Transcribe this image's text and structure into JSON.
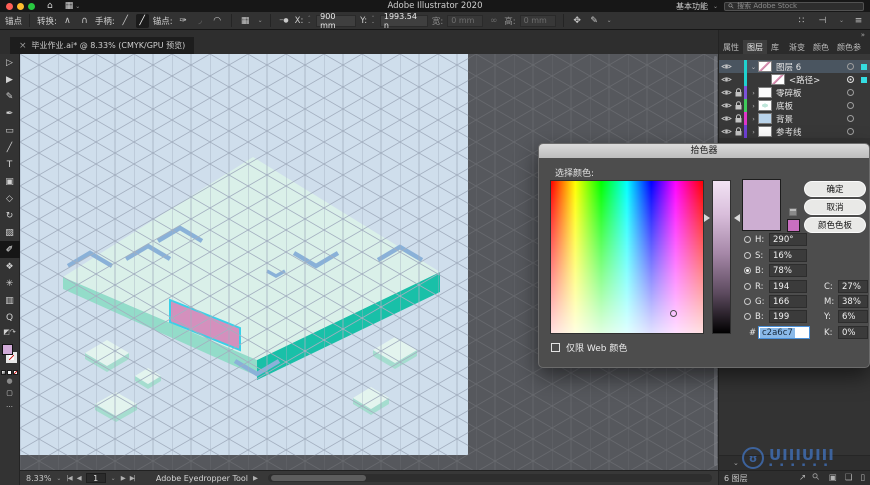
{
  "window_controls": {
    "close_color": "#ff5f57",
    "minimize_color": "#febc2e",
    "zoom_color": "#28c840"
  },
  "menubar": {
    "title": "Adobe Illustrator 2020",
    "home_icon": "⌂",
    "layout_icon": "▦",
    "chevron": "⌄",
    "workspace": "基本功能",
    "search_placeholder": "搜索 Adobe Stock",
    "search_icon": "⚲"
  },
  "controlbar": {
    "tool_label": "锚点",
    "convert_label": "转换:",
    "convert_corner_icon": "∧",
    "convert_smooth_icon": "∩",
    "handles_label": "手柄:",
    "handle_show_icon": "╱",
    "handle_hide_icon": "╱",
    "anchors_label": "锚点:",
    "anchor_pen_icon": "✑",
    "anchor_corner_icon": "◞",
    "anchor_smooth_icon": "◠",
    "grid_icon": "▦",
    "point_icon": "─●",
    "x_label": "X:",
    "x_value": "900 mm",
    "y_label": "Y:",
    "y_value": "1993.54 n",
    "w_label": "宽:",
    "w_value": "0 mm",
    "link_icon": "∞",
    "h_label": "高:",
    "h_value": "0 mm",
    "transform_icon": "✥",
    "shape_icon": "✎",
    "dots_icon": "∷",
    "dock_icon": "⊣",
    "menu_icon": "≡",
    "stepper_up": "⌃",
    "stepper_down": "⌄",
    "chevron": "⌄"
  },
  "docbar": {
    "close": "×",
    "tab_title": "毕业作业.ai* @ 8.33% (CMYK/GPU 预览)"
  },
  "tools": [
    {
      "name": "selection-tool",
      "glyph": "▷"
    },
    {
      "name": "direct-selection-tool",
      "glyph": "▶"
    },
    {
      "name": "curvature-tool",
      "glyph": "✎"
    },
    {
      "name": "pen-tool",
      "glyph": "✒"
    },
    {
      "name": "rectangle-tool",
      "glyph": "▭"
    },
    {
      "name": "paintbrush-tool",
      "glyph": "╱"
    },
    {
      "name": "type-tool",
      "glyph": "T"
    },
    {
      "name": "artboard-tool",
      "glyph": "▣"
    },
    {
      "name": "shaper-tool",
      "glyph": "◇"
    },
    {
      "name": "rotate-tool",
      "glyph": "↻"
    },
    {
      "name": "gradient-tool",
      "glyph": "▨"
    },
    {
      "name": "eyedropper-tool",
      "glyph": "✐"
    },
    {
      "name": "blend-tool",
      "glyph": "❖"
    },
    {
      "name": "symbol-sprayer-tool",
      "glyph": "✳"
    },
    {
      "name": "column-graph-tool",
      "glyph": "▥"
    },
    {
      "name": "zoom-tool",
      "glyph": "Q"
    }
  ],
  "toolbar_widgets": {
    "toggle_icon": "◩",
    "swap_icon": "↷",
    "draw_mode_icon": "●",
    "screen_mode_icon": "▢",
    "more_icon": "…",
    "fill_color": "#d2abd8"
  },
  "canvas": {
    "colors": {
      "outer": "#56585d",
      "grid_outer": "#67696e",
      "artboard": "#cfdeec",
      "grid_artboard": "#a3afc0",
      "platform_top": "#daf0e9",
      "edge_se": "#19c0a8",
      "edge_sw": "#93dcc9",
      "chevron": "#8ab1d8",
      "wall": "#d490bd",
      "wall_outline": "#3ad0e8",
      "tile_top": "#e3f4ee",
      "tile_side": "#a5ddcf"
    }
  },
  "statusbar": {
    "zoom": "8.33%",
    "chevron": "⌄",
    "nav_first": "|◀",
    "nav_prev": "◀",
    "page": "1",
    "nav_next": "▶",
    "nav_last": "▶|",
    "tool": "Adobe Eyedropper Tool",
    "expand": "▶"
  },
  "picker": {
    "title": "拾色器",
    "select_label": "选择颜色:",
    "buttons": {
      "ok": "确定",
      "cancel": "取消",
      "swatches": "颜色色板"
    },
    "rows": [
      {
        "label": "H:",
        "value": "290°"
      },
      {
        "label": "S:",
        "value": "16%"
      },
      {
        "label": "B:",
        "value": "78%"
      },
      {
        "label": "R:",
        "value": "194"
      },
      {
        "label": "G:",
        "value": "166"
      },
      {
        "label": "B:",
        "value": "199"
      }
    ],
    "hex_label": "#",
    "hex_value": "c2a6c7",
    "cmyk": [
      {
        "label": "C:",
        "value": "27%"
      },
      {
        "label": "M:",
        "value": "38%"
      },
      {
        "label": "Y:",
        "value": "6%"
      },
      {
        "label": "K:",
        "value": "0%"
      }
    ],
    "web_only_label": "仅限 Web 颜色",
    "current_color": "#cdaed2",
    "previous_color": "#c96fc0"
  },
  "layers_panel": {
    "collapse_icon": "»",
    "tabs": [
      "属性",
      "图层",
      "库",
      "渐变",
      "颜色",
      "颜色参"
    ],
    "menu_icon": "≡",
    "rows": [
      {
        "label": "图层 6",
        "color": "#1fd1cf",
        "chevron": "⌄"
      },
      {
        "label": "<路径>",
        "color": "#1fd1cf",
        "chevron": ""
      },
      {
        "label": "零碎板",
        "color": "#7b52db",
        "chevron": "›"
      },
      {
        "label": "底板",
        "color": "#3fcb5a",
        "chevron": "›"
      },
      {
        "label": "背景",
        "color": "#e036c8",
        "chevron": "›"
      },
      {
        "label": "参考线",
        "color": "#6e3fd4",
        "chevron": "›"
      }
    ],
    "selection_color": "#35dde2",
    "strip_chevron": "⌄",
    "footer_count": "6 图层",
    "footer_icons": {
      "export": "↗",
      "locate": "⚲",
      "mask": "▣",
      "new_layer": "❏",
      "delete": "▯"
    }
  },
  "watermark": {
    "logo": "ʊ",
    "text": "UIIIUIII",
    "dots": "▪ ▪ ▪ ▪ ▪ ▪"
  }
}
